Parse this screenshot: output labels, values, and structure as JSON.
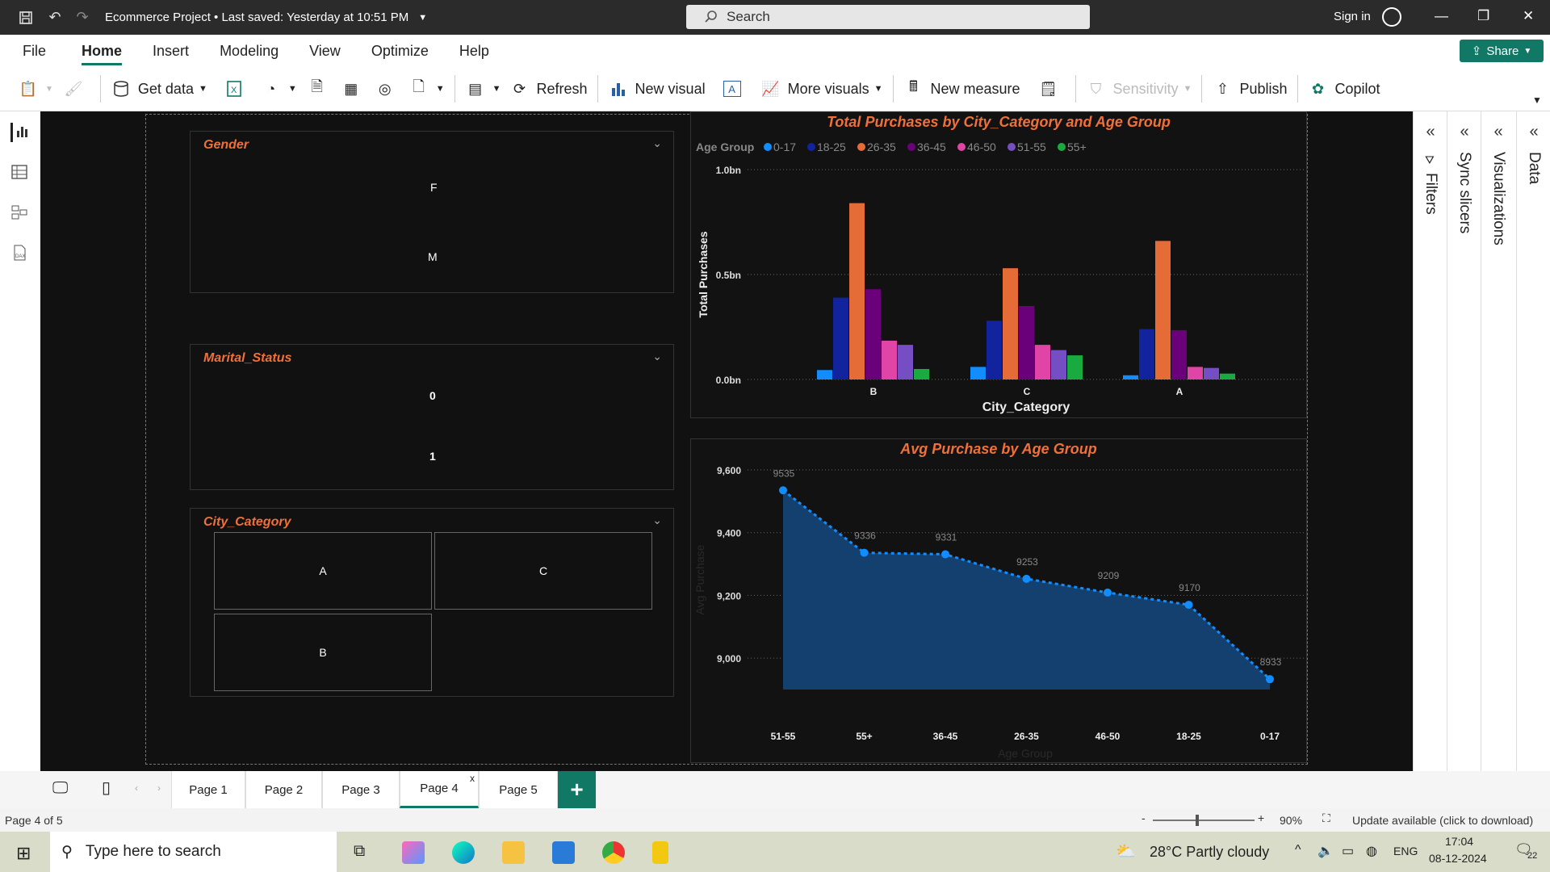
{
  "window": {
    "title": "Ecommerce Project • Last saved: Yesterday at 10:51 PM",
    "search_placeholder": "Search",
    "sign_in": "Sign in"
  },
  "menu": {
    "items": [
      "File",
      "Home",
      "Insert",
      "Modeling",
      "View",
      "Optimize",
      "Help"
    ],
    "active": "Home",
    "share": "Share"
  },
  "ribbon": {
    "get_data": "Get data",
    "refresh": "Refresh",
    "new_visual": "New visual",
    "more_visuals": "More visuals",
    "new_measure": "New measure",
    "sensitivity": "Sensitivity",
    "publish": "Publish",
    "copilot": "Copilot"
  },
  "slicers": {
    "gender": {
      "title": "Gender",
      "items": [
        "F",
        "M"
      ]
    },
    "marital": {
      "title": "Marital_Status",
      "items": [
        "0",
        "1"
      ]
    },
    "city": {
      "title": "City_Category",
      "items": [
        "A",
        "C",
        "B"
      ]
    }
  },
  "bar_chart": {
    "title": "Total Purchases by City_Category and Age Group",
    "legend_title": "Age Group",
    "ylabel": "Total Purchases",
    "xlabel": "City_Category",
    "yticks": [
      "1.0bn",
      "0.5bn",
      "0.0bn"
    ]
  },
  "area_chart": {
    "title": "Avg Purchase by Age Group",
    "ylabel": "Avg Purchase",
    "xlabel": "Age Group",
    "yticks": [
      "9,600",
      "9,400",
      "9,200",
      "9,000"
    ]
  },
  "chart_data": [
    {
      "type": "bar",
      "title": "Total Purchases by City_Category and Age Group",
      "xlabel": "City_Category",
      "ylabel": "Total Purchases",
      "ylim": [
        0,
        1000000000
      ],
      "categories": [
        "B",
        "C",
        "A"
      ],
      "series": [
        {
          "name": "0-17",
          "color": "#118dff",
          "values": [
            45000000,
            60000000,
            20000000
          ]
        },
        {
          "name": "18-25",
          "color": "#12239e",
          "values": [
            390000000,
            280000000,
            240000000
          ]
        },
        {
          "name": "26-35",
          "color": "#e66c37",
          "values": [
            840000000,
            530000000,
            660000000
          ]
        },
        {
          "name": "36-45",
          "color": "#6b007b",
          "values": [
            430000000,
            350000000,
            235000000
          ]
        },
        {
          "name": "46-50",
          "color": "#e044a7",
          "values": [
            185000000,
            165000000,
            60000000
          ]
        },
        {
          "name": "51-55",
          "color": "#744ec2",
          "values": [
            165000000,
            140000000,
            55000000
          ]
        },
        {
          "name": "55+",
          "color": "#1aab40",
          "values": [
            50000000,
            115000000,
            28000000
          ]
        }
      ],
      "legend": "top-left",
      "grid": true
    },
    {
      "type": "area",
      "title": "Avg Purchase by Age Group",
      "xlabel": "Age Group",
      "ylabel": "Avg Purchase",
      "ylim": [
        8900,
        9600
      ],
      "categories": [
        "51-55",
        "55+",
        "36-45",
        "26-35",
        "46-50",
        "18-25",
        "0-17"
      ],
      "values": [
        9535,
        9336,
        9331,
        9253,
        9209,
        9170,
        8933
      ],
      "color": "#118dff",
      "grid": true
    }
  ],
  "right_panels": [
    "Filters",
    "Sync slicers",
    "Visualizations",
    "Data"
  ],
  "pages": {
    "tabs": [
      "Page 1",
      "Page 2",
      "Page 3",
      "Page 4",
      "Page 5"
    ],
    "active": "Page 4",
    "status": "Page 4 of 5",
    "zoom": "90%",
    "update": "Update available (click to download)"
  },
  "taskbar": {
    "search": "Type here to search",
    "weather": "28°C  Partly cloudy",
    "lang": "ENG",
    "time": "17:04",
    "date": "08-12-2024",
    "notif": "22"
  }
}
